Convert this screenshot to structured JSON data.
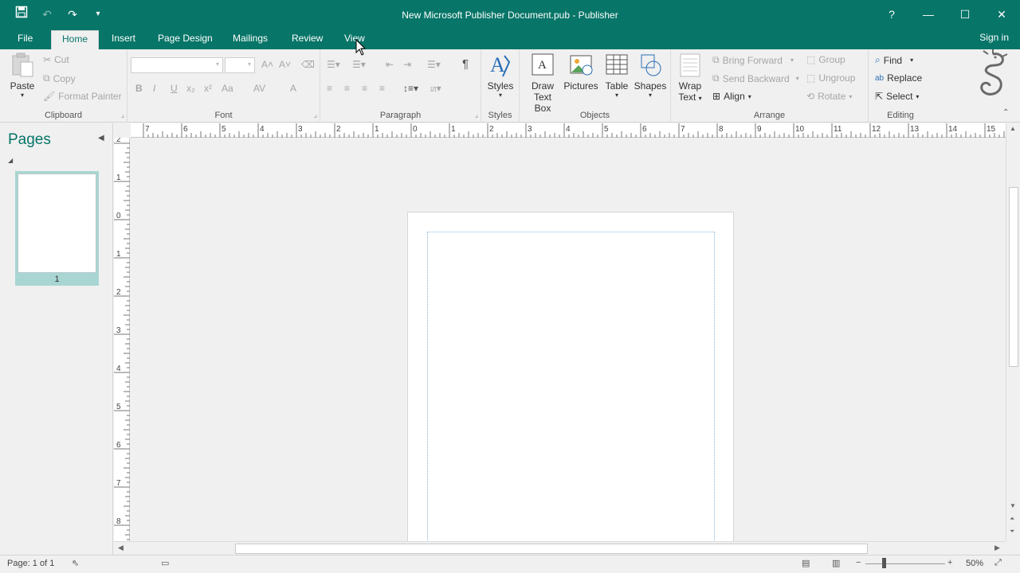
{
  "window": {
    "title": "New Microsoft Publisher Document.pub - Publisher",
    "help": "?",
    "minimize": "—",
    "maximize": "☐",
    "close": "✕"
  },
  "qat": {
    "save": "💾",
    "undo": "↶",
    "redo": "↷",
    "customize": "▾"
  },
  "tabs": [
    "File",
    "Home",
    "Insert",
    "Page Design",
    "Mailings",
    "Review",
    "View"
  ],
  "active_tab": "Home",
  "signin": "Sign in",
  "ribbon": {
    "clipboard": {
      "label": "Clipboard",
      "paste": "Paste",
      "cut": "Cut",
      "copy": "Copy",
      "format_painter": "Format Painter"
    },
    "font": {
      "label": "Font",
      "bold": "B",
      "italic": "I",
      "underline": "U",
      "subscript": "x₂",
      "superscript": "x²",
      "change_case": "Aa",
      "spacing": "AV",
      "color": "A",
      "grow": "A˄",
      "shrink": "A˅"
    },
    "paragraph": {
      "label": "Paragraph",
      "show_marks": "¶"
    },
    "styles": {
      "label": "Styles",
      "button": "Styles"
    },
    "objects": {
      "label": "Objects",
      "draw_text_box_1": "Draw",
      "draw_text_box_2": "Text Box",
      "pictures": "Pictures",
      "table": "Table",
      "shapes": "Shapes"
    },
    "arrange": {
      "label": "Arrange",
      "wrap_text_1": "Wrap",
      "wrap_text_2": "Text",
      "bring_forward": "Bring Forward",
      "send_backward": "Send Backward",
      "align": "Align",
      "group": "Group",
      "ungroup": "Ungroup",
      "rotate": "Rotate"
    },
    "editing": {
      "label": "Editing",
      "find": "Find",
      "replace": "Replace",
      "select": "Select"
    }
  },
  "pages_pane": {
    "title": "Pages",
    "thumbnail_number": "1"
  },
  "hruler_labels": [
    "7",
    "6",
    "5",
    "4",
    "3",
    "2",
    "1",
    "0",
    "1",
    "2",
    "3",
    "4",
    "5",
    "6",
    "7",
    "8",
    "9",
    "10",
    "11",
    "12",
    "13",
    "14",
    "15"
  ],
  "vruler_labels": [
    "2",
    "1",
    "0",
    "1",
    "2",
    "3",
    "4",
    "5",
    "6",
    "7",
    "8"
  ],
  "status": {
    "page_info": "Page: 1 of 1",
    "zoom": "50%"
  },
  "colors": {
    "accent": "#077568",
    "workspace": "#f0f0f0",
    "margin_guide": "#8ab4d9"
  }
}
